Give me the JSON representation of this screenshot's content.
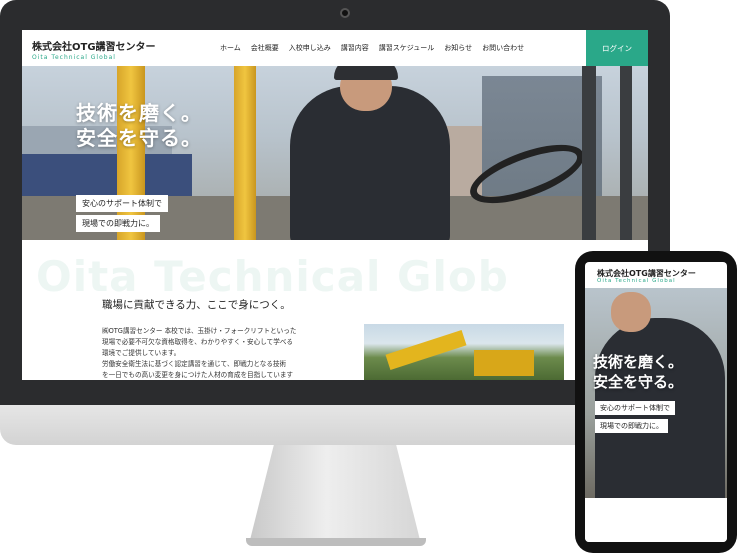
{
  "desktop": {
    "brand": {
      "name": "株式会社OTG講習センター",
      "sub": "Oita Technical Global"
    },
    "nav": [
      "ホーム",
      "会社概要",
      "入校申し込み",
      "講習内容",
      "講習スケジュール",
      "お知らせ",
      "お問い合わせ"
    ],
    "login": "ログイン",
    "hero": {
      "title_lines": [
        "技術を磨く。",
        "安全を守る。"
      ],
      "tag1": "安心のサポート体制で",
      "tag2": "現場での即戦力に。"
    },
    "section": {
      "bg_text": "Oita Technical Glob",
      "heading": "職場に貢献できる力、ここで身につく。",
      "body_lines": [
        "㈱OTG講習センター 本校では、玉掛け・フォークリフトといった",
        "現場で必要不可欠な資格取得を、わかりやすく・安心して学べる",
        "環境でご提供しています。",
        "労働安全衛生法に基づく認定講習を通じて、即戦力となる技術",
        "を一日でもの高い変更を身につけた人材の育成を目指しています"
      ]
    }
  },
  "mobile": {
    "brand": {
      "name": "株式会社OTG講習センター",
      "sub": "Oita Technical Global"
    },
    "hero": {
      "title_lines": [
        "技術を磨く。",
        "安全を守る。"
      ],
      "tag1": "安心のサポート体制で",
      "tag2": "現場での即戦力に。"
    }
  },
  "colors": {
    "accent": "#2aa889",
    "frame": "#2b2c2e"
  }
}
